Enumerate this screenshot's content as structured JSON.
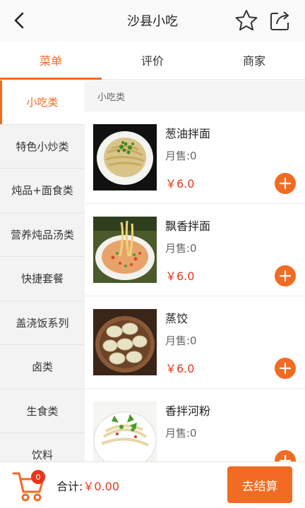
{
  "header": {
    "title": "沙县小吃",
    "back_icon": "back-arrow-icon",
    "star_icon": "star-icon",
    "share_icon": "share-icon"
  },
  "tabs": [
    {
      "label": "菜单",
      "active": true
    },
    {
      "label": "评价",
      "active": false
    },
    {
      "label": "商家",
      "active": false
    }
  ],
  "sidebar": {
    "items": [
      {
        "label": "小吃类",
        "active": true
      },
      {
        "label": "特色小炒类"
      },
      {
        "label": "炖品+面食类"
      },
      {
        "label": "营养炖品汤类"
      },
      {
        "label": "快捷套餐"
      },
      {
        "label": "盖浇饭系列"
      },
      {
        "label": "卤类"
      },
      {
        "label": "生食类"
      },
      {
        "label": "饮料"
      }
    ]
  },
  "section": {
    "title": "小吃类"
  },
  "items": [
    {
      "name": "葱油拌面",
      "sales": "月售:0",
      "price": "￥6.0"
    },
    {
      "name": "飘香拌面",
      "sales": "月售:0",
      "price": "￥6.0"
    },
    {
      "name": "蒸饺",
      "sales": "月售:0",
      "price": "￥6.0"
    },
    {
      "name": "香拌河粉",
      "sales": "月售:0",
      "price": ""
    }
  ],
  "footer": {
    "cart_count": "0",
    "total_label": "合计:",
    "total_amount": "￥0.00",
    "checkout_label": "去结算"
  },
  "colors": {
    "accent": "#f26b22",
    "price": "#e8361c"
  }
}
